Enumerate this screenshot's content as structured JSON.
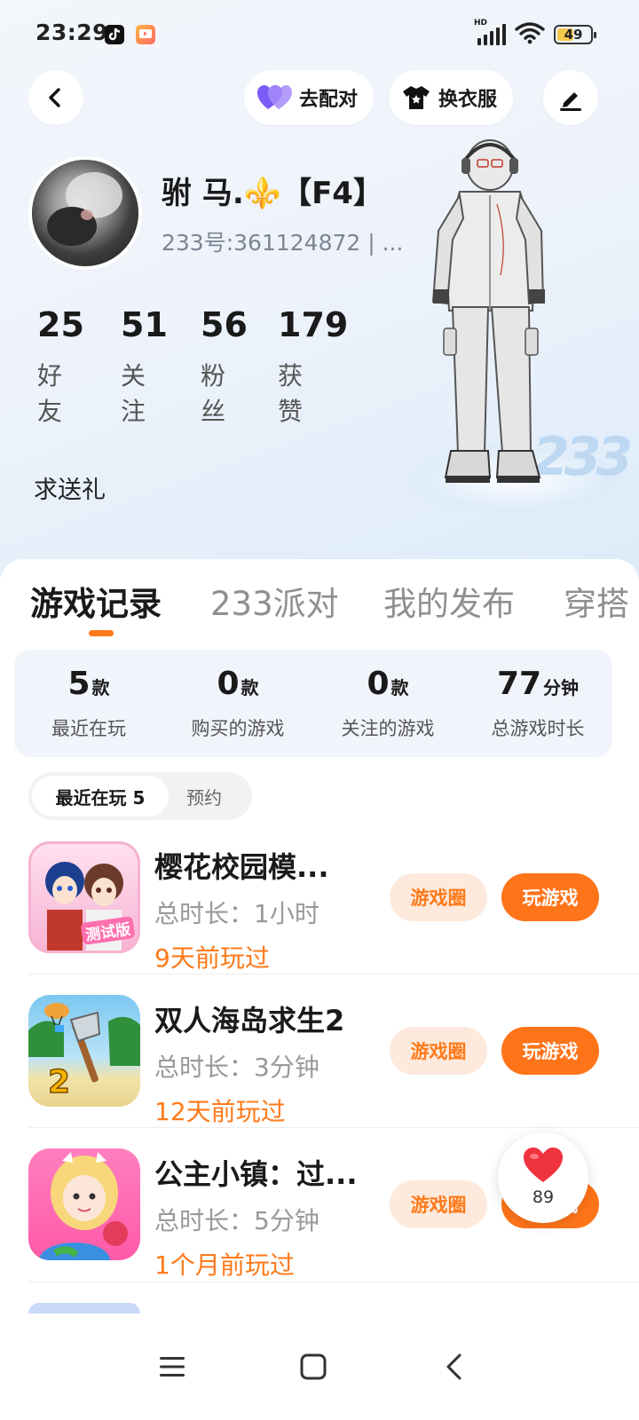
{
  "status_bar": {
    "time": "23:29",
    "signal_label": "HD",
    "battery_level": 49,
    "battery_text": "49"
  },
  "top_actions": {
    "match_label": "去配对",
    "dress_label": "换衣服"
  },
  "profile": {
    "name": "驸 马.⚜️【F4】",
    "id_line": "233号:361124872 | ...",
    "stats": [
      {
        "value": "25",
        "label": "好友"
      },
      {
        "value": "51",
        "label": "关注"
      },
      {
        "value": "56",
        "label": "粉丝"
      },
      {
        "value": "179",
        "label": "获赞"
      }
    ],
    "bio": "求送礼",
    "pedestal_text": "233"
  },
  "tabs": [
    {
      "label": "游戏记录",
      "active": true
    },
    {
      "label": "233派对",
      "active": false
    },
    {
      "label": "我的发布",
      "active": false
    },
    {
      "label": "穿搭",
      "active": false
    }
  ],
  "summary": [
    {
      "value": "5",
      "unit": "款",
      "label": "最近在玩"
    },
    {
      "value": "0",
      "unit": "款",
      "label": "购买的游戏"
    },
    {
      "value": "0",
      "unit": "款",
      "label": "关注的游戏"
    },
    {
      "value": "77",
      "unit": "分钟",
      "label": "总游戏时长"
    }
  ],
  "filters": {
    "recent": "最近在玩 5",
    "reserve": "预约"
  },
  "games": [
    {
      "title": "樱花校园模...",
      "duration": "总时长：1小时",
      "last_played": "9天前玩过",
      "circle_label": "游戏圈",
      "play_label": "玩游戏",
      "icon_badge": "测试版"
    },
    {
      "title": "双人海岛求生2",
      "duration": "总时长：3分钟",
      "last_played": "12天前玩过",
      "circle_label": "游戏圈",
      "play_label": "玩游戏",
      "icon_badge": "2"
    },
    {
      "title": "公主小镇：过...",
      "duration": "总时长：5分钟",
      "last_played": "1个月前玩过",
      "circle_label": "游戏圈",
      "play_label": "玩游戏",
      "icon_badge": ""
    }
  ],
  "like_float": {
    "count": "89"
  },
  "colors": {
    "accent": "#ff7419",
    "accent_light": "#fdeadc",
    "summary_bg": "#f1f5fb",
    "heart": "#f0343f",
    "heart_purple": "#7b5cf5"
  },
  "icons": {
    "back": "chevron-left-icon",
    "match": "heart-icon",
    "dress": "shirt-icon",
    "edit": "pencil-icon",
    "nav_menu": "menu-icon",
    "nav_home": "square-icon",
    "nav_back": "chevron-left-icon"
  }
}
